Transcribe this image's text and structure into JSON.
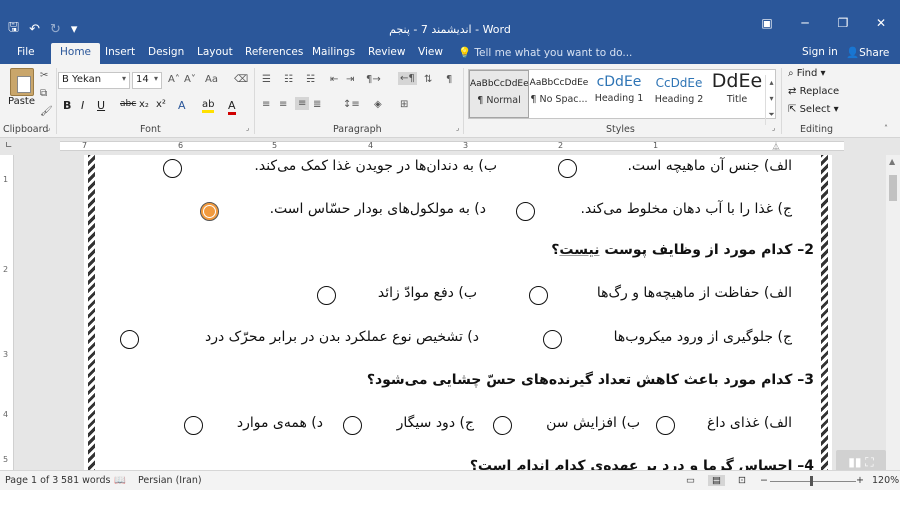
{
  "window": {
    "title": "اندیشمند 7 - پنجم - Word",
    "controls": [
      "▣",
      "─",
      "❐",
      "✕"
    ]
  },
  "qat": {
    "save_icon": "save-icon",
    "undo_icon": "undo-icon",
    "redo_icon": "redo-icon",
    "customize": "▾"
  },
  "tabs": [
    "File",
    "Home",
    "Insert",
    "Design",
    "Layout",
    "References",
    "Mailings",
    "Review",
    "View"
  ],
  "active_tab": "Home",
  "tell_me": "Tell me what you want to do...",
  "sign_in": "Sign in",
  "share": "Share",
  "ribbon": {
    "clipboard": {
      "label": "Clipboard",
      "paste": "Paste"
    },
    "font": {
      "label": "Font",
      "name": "B Yekan",
      "size": "14",
      "grow": "A˄",
      "shrink": "A˅",
      "case": "Aa",
      "bold": "B",
      "italic": "I",
      "underline": "U",
      "strike": "abc",
      "sub": "x₂",
      "sup": "x²",
      "effects": "A",
      "highlight": "ab",
      "color": "A"
    },
    "paragraph": {
      "label": "Paragraph",
      "pilcrow": "¶"
    },
    "styles": {
      "label": "Styles",
      "items": [
        {
          "preview": "AaBbCcDdEe",
          "name": "¶ Normal"
        },
        {
          "preview": "AaBbCcDdEe",
          "name": "¶ No Spac..."
        },
        {
          "preview": "cDdEe",
          "name": "Heading 1"
        },
        {
          "preview": "CcDdEe",
          "name": "Heading 2"
        },
        {
          "preview": "DdEe",
          "name": "Title"
        }
      ]
    },
    "editing": {
      "label": "Editing",
      "find": "Find",
      "replace": "Replace",
      "select": "Select"
    }
  },
  "ruler": {
    "numbers": [
      "7",
      "6",
      "5",
      "4",
      "3",
      "2",
      "1"
    ],
    "vertical": [
      "1",
      "2",
      "3",
      "4",
      "5"
    ]
  },
  "document": {
    "q1_options": {
      "alef": "الف) جنس آن ماهیچه است.",
      "be": "ب)  به دندان‌ها در جویدن غذا کمک می‌کند.",
      "jim": "ج) غذا را با آب دهان مخلوط می‌کند.",
      "dal": "د) به مولکول‌های بودار حسّاس است."
    },
    "q2": {
      "number": "2–",
      "text_before": "کدام مورد از وظایف پوست ",
      "text_underlined": "نیست",
      "text_after": "؟"
    },
    "q2_options": {
      "alef": "الف) حفاظت از ماهیچه‌ها و رگ‌ها",
      "be": "ب) دفع موادّ زائد",
      "jim": "ج) جلوگیری از ورود میکروب‌ها",
      "dal": "د) تشخیص نوع عملکرد بدن در برابر محرّک درد"
    },
    "q3": {
      "number": "3–",
      "text": "کدام مورد باعث کاهش تعداد گیرنده‌های حسّ چشایی می‌شود؟"
    },
    "q3_options": {
      "alef": "الف) غذای داغ",
      "be": "ب) افزایش سن",
      "jim": "ج) دود سیگار",
      "dal": "د) همه‌ی موارد"
    },
    "q4_partial": "4– احساس گرما و درد بر عهده‌ی کدام اندام است؟",
    "selected_answer": "q1.dal"
  },
  "status": {
    "page": "Page 1 of 3",
    "words": "581 words",
    "language": "Persian (Iran)",
    "zoom": "120%",
    "zoom_minus": "−",
    "zoom_plus": "+"
  },
  "colors": {
    "accent": "#2b579a",
    "selected_radio": "#f19a3e"
  }
}
